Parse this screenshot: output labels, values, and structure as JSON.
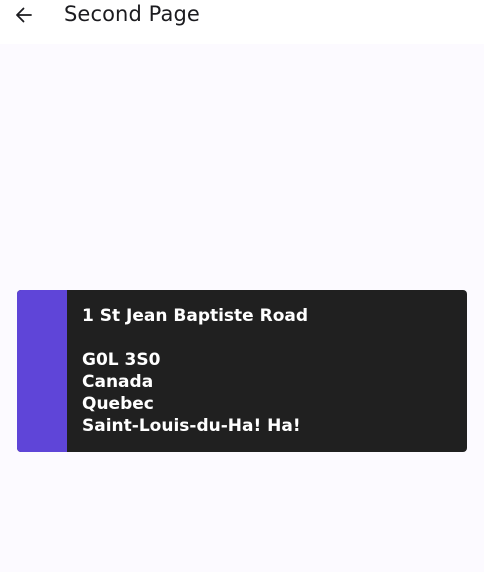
{
  "appbar": {
    "back_icon": "arrow-left-icon",
    "title": "Second Page"
  },
  "card": {
    "accent_color": "#5f45d8",
    "street": "1 St Jean Baptiste Road",
    "postal_code": "G0L 3S0",
    "country": "Canada",
    "province": "Quebec",
    "city": "Saint-Louis-du-Ha! Ha!"
  }
}
